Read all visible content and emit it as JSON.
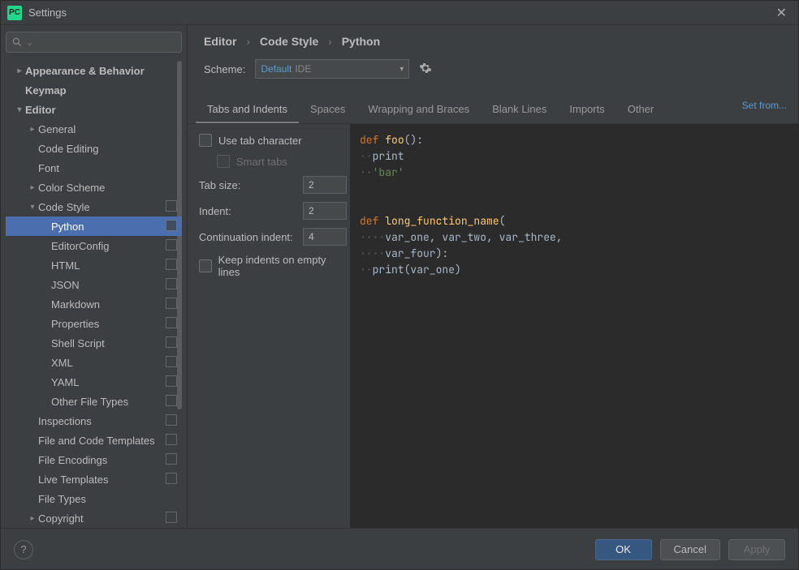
{
  "window": {
    "title": "Settings"
  },
  "search": {
    "placeholder": ""
  },
  "tree": [
    {
      "label": "Appearance & Behavior",
      "indent": 0,
      "bold": true,
      "arrow": "closed",
      "squares": false
    },
    {
      "label": "Keymap",
      "indent": 0,
      "bold": true,
      "arrow": "",
      "squares": false
    },
    {
      "label": "Editor",
      "indent": 0,
      "bold": true,
      "arrow": "open",
      "squares": false
    },
    {
      "label": "General",
      "indent": 1,
      "bold": false,
      "arrow": "closed",
      "squares": false
    },
    {
      "label": "Code Editing",
      "indent": 1,
      "bold": false,
      "arrow": "",
      "squares": false
    },
    {
      "label": "Font",
      "indent": 1,
      "bold": false,
      "arrow": "",
      "squares": false
    },
    {
      "label": "Color Scheme",
      "indent": 1,
      "bold": false,
      "arrow": "closed",
      "squares": false
    },
    {
      "label": "Code Style",
      "indent": 1,
      "bold": false,
      "arrow": "open",
      "squares": true
    },
    {
      "label": "Python",
      "indent": 2,
      "bold": false,
      "arrow": "",
      "squares": true,
      "selected": true
    },
    {
      "label": "EditorConfig",
      "indent": 2,
      "bold": false,
      "arrow": "",
      "squares": true
    },
    {
      "label": "HTML",
      "indent": 2,
      "bold": false,
      "arrow": "",
      "squares": true
    },
    {
      "label": "JSON",
      "indent": 2,
      "bold": false,
      "arrow": "",
      "squares": true
    },
    {
      "label": "Markdown",
      "indent": 2,
      "bold": false,
      "arrow": "",
      "squares": true
    },
    {
      "label": "Properties",
      "indent": 2,
      "bold": false,
      "arrow": "",
      "squares": true
    },
    {
      "label": "Shell Script",
      "indent": 2,
      "bold": false,
      "arrow": "",
      "squares": true
    },
    {
      "label": "XML",
      "indent": 2,
      "bold": false,
      "arrow": "",
      "squares": true
    },
    {
      "label": "YAML",
      "indent": 2,
      "bold": false,
      "arrow": "",
      "squares": true
    },
    {
      "label": "Other File Types",
      "indent": 2,
      "bold": false,
      "arrow": "",
      "squares": true
    },
    {
      "label": "Inspections",
      "indent": 1,
      "bold": false,
      "arrow": "",
      "squares": true
    },
    {
      "label": "File and Code Templates",
      "indent": 1,
      "bold": false,
      "arrow": "",
      "squares": true
    },
    {
      "label": "File Encodings",
      "indent": 1,
      "bold": false,
      "arrow": "",
      "squares": true
    },
    {
      "label": "Live Templates",
      "indent": 1,
      "bold": false,
      "arrow": "",
      "squares": true
    },
    {
      "label": "File Types",
      "indent": 1,
      "bold": false,
      "arrow": "",
      "squares": false
    },
    {
      "label": "Copyright",
      "indent": 1,
      "bold": false,
      "arrow": "closed",
      "squares": true
    }
  ],
  "breadcrumbs": [
    "Editor",
    "Code Style",
    "Python"
  ],
  "scheme": {
    "label": "Scheme:",
    "name": "Default",
    "badge": "IDE"
  },
  "set_from": "Set from...",
  "tabs": [
    "Tabs and Indents",
    "Spaces",
    "Wrapping and Braces",
    "Blank Lines",
    "Imports",
    "Other"
  ],
  "active_tab": 0,
  "controls": {
    "use_tab_char": "Use tab character",
    "smart_tabs": "Smart tabs",
    "tab_size_label": "Tab size:",
    "tab_size_value": "2",
    "indent_label": "Indent:",
    "indent_value": "2",
    "cont_indent_label": "Continuation indent:",
    "cont_indent_value": "4",
    "keep_indents": "Keep indents on empty lines"
  },
  "footer": {
    "ok": "OK",
    "cancel": "Cancel",
    "apply": "Apply"
  }
}
